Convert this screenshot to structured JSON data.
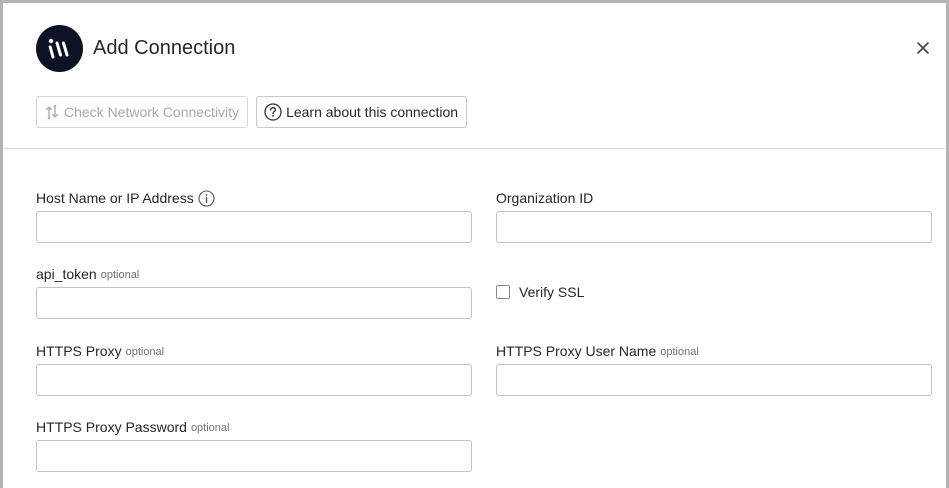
{
  "dialog": {
    "title": "Add Connection",
    "logo_icon": "brand-logo-icon",
    "close_icon": "close-icon"
  },
  "toolbar": {
    "check_network_label": "Check Network Connectivity",
    "check_network_icon": "network-check-icon",
    "learn_label": "Learn about this connection",
    "learn_icon": "help-circle-icon"
  },
  "form": {
    "optional_text": "optional",
    "host": {
      "label": "Host Name or IP Address",
      "value": "",
      "placeholder": ""
    },
    "org_id": {
      "label": "Organization ID",
      "value": "",
      "placeholder": ""
    },
    "api_token": {
      "label": "api_token",
      "value": "",
      "placeholder": ""
    },
    "verify_ssl": {
      "label": "Verify SSL",
      "checked": false
    },
    "https_proxy": {
      "label": "HTTPS Proxy",
      "value": "",
      "placeholder": ""
    },
    "https_proxy_user": {
      "label": "HTTPS Proxy User Name",
      "value": "",
      "placeholder": ""
    },
    "https_proxy_password": {
      "label": "HTTPS Proxy Password",
      "value": "",
      "placeholder": ""
    }
  },
  "colors": {
    "logo_bg": "#0d1324",
    "border": "#c4c4c4",
    "disabled_text": "#a8a8a8"
  }
}
